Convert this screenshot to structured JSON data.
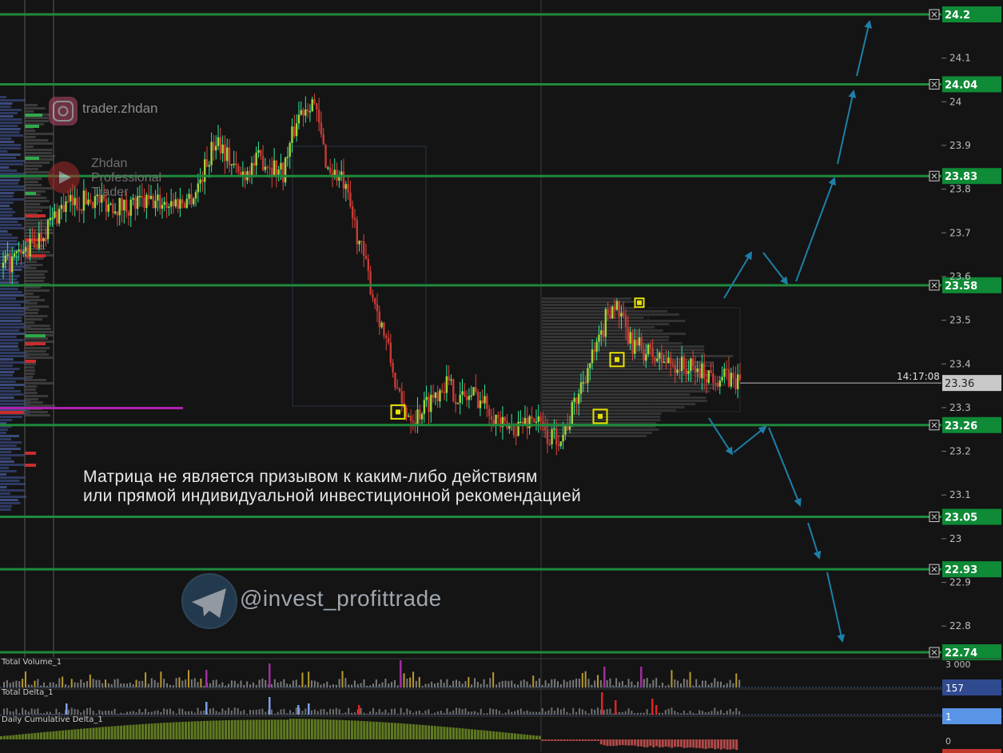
{
  "chart_data": {
    "type": "candlestick",
    "ylim": [
      22.72,
      24.26
    ],
    "y_ticks": [
      "24.1",
      "24",
      "23.9",
      "23.8",
      "23.7",
      "23.6",
      "23.5",
      "23.4",
      "23.3",
      "23.2",
      "23.1",
      "23",
      "22.9",
      "22.8"
    ],
    "y_tick_values": [
      24.1,
      24.0,
      23.9,
      23.8,
      23.7,
      23.6,
      23.5,
      23.4,
      23.3,
      23.2,
      23.1,
      23.0,
      22.9,
      22.8
    ],
    "levels": [
      {
        "label": "24.2",
        "value": 24.2
      },
      {
        "label": "24.04",
        "value": 24.04
      },
      {
        "label": "23.83",
        "value": 23.83
      },
      {
        "label": "23.58",
        "value": 23.58
      },
      {
        "label": "23.26",
        "value": 23.26
      },
      {
        "label": "23.05",
        "value": 23.05
      },
      {
        "label": "22.93",
        "value": 22.93
      },
      {
        "label": "22.74",
        "value": 22.74
      }
    ],
    "last_price": {
      "label": "23.36",
      "value": 23.36,
      "time": "14:17:08"
    },
    "price_path": [
      [
        0,
        23.62
      ],
      [
        0.04,
        23.67
      ],
      [
        0.08,
        23.76
      ],
      [
        0.12,
        23.78
      ],
      [
        0.16,
        23.76
      ],
      [
        0.2,
        23.77
      ],
      [
        0.24,
        23.77
      ],
      [
        0.26,
        23.79
      ],
      [
        0.29,
        23.92
      ],
      [
        0.32,
        23.83
      ],
      [
        0.35,
        23.87
      ],
      [
        0.38,
        23.84
      ],
      [
        0.4,
        23.97
      ],
      [
        0.42,
        24.01
      ],
      [
        0.44,
        23.85
      ],
      [
        0.46,
        23.82
      ],
      [
        0.48,
        23.7
      ],
      [
        0.5,
        23.57
      ],
      [
        0.52,
        23.45
      ],
      [
        0.54,
        23.3
      ],
      [
        0.56,
        23.28
      ],
      [
        0.58,
        23.32
      ],
      [
        0.6,
        23.36
      ],
      [
        0.62,
        23.32
      ],
      [
        0.64,
        23.33
      ],
      [
        0.66,
        23.3
      ],
      [
        0.68,
        23.25
      ],
      [
        0.7,
        23.26
      ],
      [
        0.72,
        23.28
      ],
      [
        0.74,
        23.23
      ],
      [
        0.76,
        23.24
      ],
      [
        0.77,
        23.28
      ],
      [
        0.79,
        23.38
      ],
      [
        0.81,
        23.45
      ],
      [
        0.82,
        23.52
      ],
      [
        0.83,
        23.54
      ],
      [
        0.85,
        23.45
      ],
      [
        0.87,
        23.43
      ],
      [
        0.89,
        23.41
      ],
      [
        0.91,
        23.4
      ],
      [
        0.93,
        23.39
      ],
      [
        0.95,
        23.38
      ],
      [
        1.0,
        23.36
      ]
    ],
    "signals": [
      23.29,
      23.28,
      23.41,
      23.54
    ],
    "panes": [
      {
        "name": "Total Volume_1",
        "scale_label": "3 000"
      },
      {
        "name": "Total Delta_1",
        "value_label": "157"
      },
      {
        "name": "Daily Cumulative Delta_1",
        "value_label": "1",
        "zero_label": "0"
      }
    ]
  },
  "texts": {
    "disclaimer_line1": "Матрица не является призывом к каким-либо действиям",
    "disclaimer_line2": "или прямой индивидуальной инвестиционной рекомендацией",
    "telegram_handle": "@invest_profittrade",
    "instagram_handle": "trader.zhdan",
    "zhdan_line1": "Zhdan",
    "zhdan_line2": "Professional",
    "zhdan_line3": "Trader"
  },
  "icons": {
    "instagram": "instagram-icon",
    "telegram": "telegram-icon",
    "youtube": "youtube-icon",
    "remove_level": "close-box-icon"
  },
  "colors": {
    "background": "#141414",
    "level_line": "#1e8a3c",
    "level_label_bg": "#0f8a36",
    "arrow": "#1e7fa8",
    "up_candle": "#2ee89a",
    "down_candle": "#e0443a",
    "bear_body": "#c93a36",
    "bull_body": "#a5d43a",
    "signal": "#e8e000",
    "delta_positive": "#7f9fe6",
    "delta_negative": "#e32222",
    "volume_bar": "#7a7a7a",
    "volume_bar_hi": "#b89a2a",
    "volume_bar_purple": "#a02da0",
    "cum_delta_pos": "#5f7a20",
    "cum_delta_neg": "#b04848",
    "last_price_bg": "#c8c8c8",
    "delta_label_bg": "#2f4a8f",
    "cum_label_bg": "#5a94e6"
  }
}
